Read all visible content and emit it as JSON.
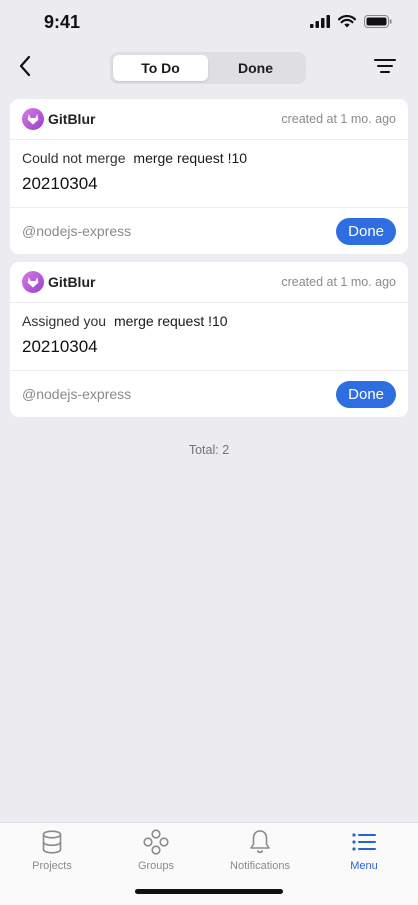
{
  "status": {
    "time": "9:41",
    "icons": [
      "signal-icon",
      "wifi-icon",
      "battery-icon"
    ]
  },
  "header": {
    "back_icon": "chevron-left-icon",
    "tabs": [
      {
        "label": "To Do",
        "active": true
      },
      {
        "label": "Done",
        "active": false
      }
    ],
    "filter_icon": "filter-lines-icon"
  },
  "todos": [
    {
      "source": "GitBlur",
      "created": "created at 1 mo. ago",
      "action": "Could not merge",
      "target": "merge request !10",
      "title": "20210304",
      "project": "@nodejs-express",
      "button": "Done"
    },
    {
      "source": "GitBlur",
      "created": "created at 1 mo. ago",
      "action": "Assigned you",
      "target": "merge request !10",
      "title": "20210304",
      "project": "@nodejs-express",
      "button": "Done"
    }
  ],
  "total": "Total: 2",
  "tab_bar": {
    "items": [
      {
        "label": "Projects",
        "icon": "database-icon",
        "active": false
      },
      {
        "label": "Groups",
        "icon": "groups-icon",
        "active": false
      },
      {
        "label": "Notifications",
        "icon": "bell-icon",
        "active": false
      },
      {
        "label": "Menu",
        "icon": "menu-list-icon",
        "active": true
      }
    ]
  },
  "colors": {
    "accent": "#2f6ee0",
    "active_tab": "#2a64d3",
    "background": "#ebebf0",
    "logo_gradient": [
      "#d77ce6",
      "#9a3fc8"
    ]
  }
}
